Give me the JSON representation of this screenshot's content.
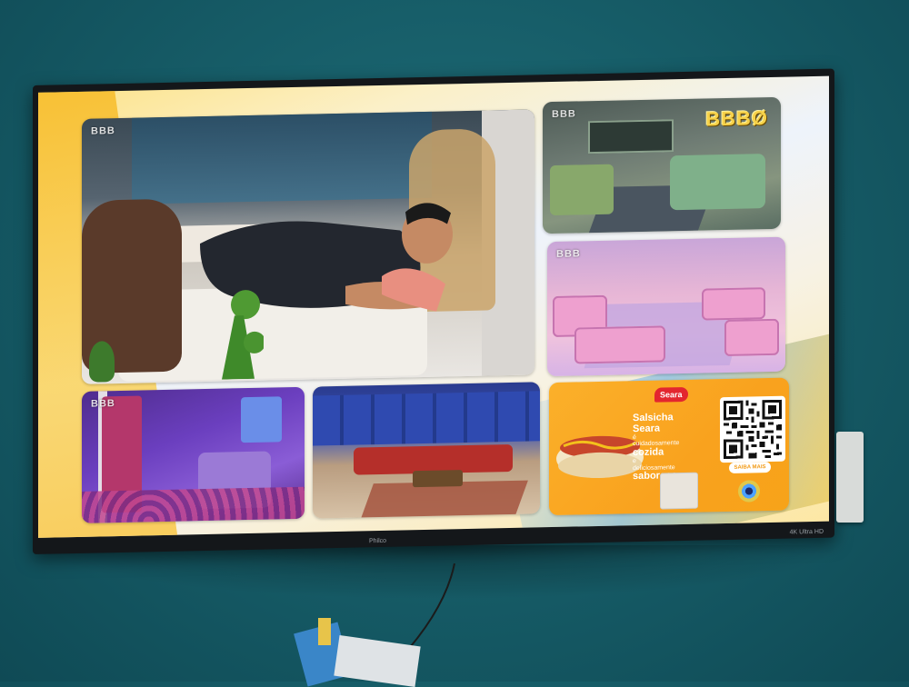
{
  "channel": {
    "logo_text": "BBB",
    "big_logo_text": "BBBØ"
  },
  "ad": {
    "brand": "Seara",
    "headline_1": "Salsicha",
    "headline_2": "Seara",
    "line_small_1": "é",
    "line_small_2": "cuidadosamente",
    "headline_3": "cozida",
    "line_small_3": "e",
    "line_small_4": "deliciosamente",
    "headline_4": "saborosa",
    "button_label": "SAIBA MAIS"
  },
  "tv": {
    "brand_left": "Philco",
    "brand_right": "4K Ultra HD"
  },
  "colors": {
    "wall": "#175e69",
    "ad_orange": "#f9a21e",
    "seara_red": "#e3262f"
  }
}
